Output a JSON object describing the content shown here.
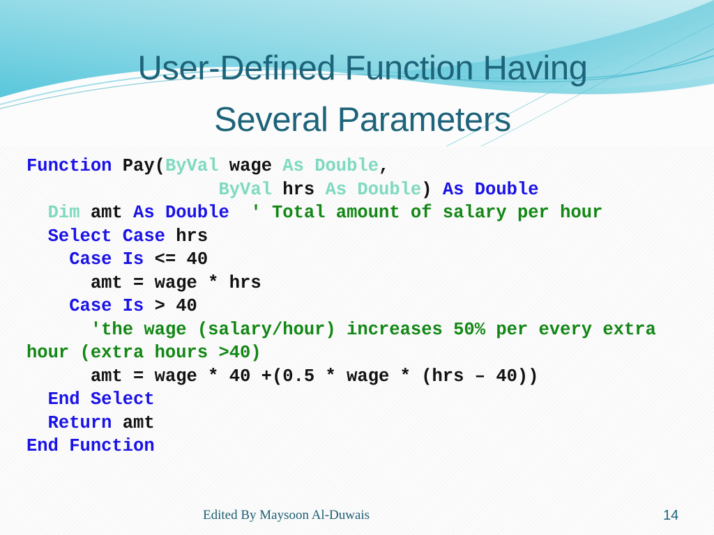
{
  "slide": {
    "title_lines": [
      "User-Defined Function Having",
      "Several Parameters"
    ],
    "footer_credit": "Edited By Maysoon Al-Duwais",
    "page_number": "14",
    "colors": {
      "title": "#1d6379",
      "keyword_blue": "#1a12e6",
      "type_mint": "#7fd9c0",
      "comment_green": "#128715",
      "plain_black": "#111111",
      "accent_cyan": "#5ec8dd",
      "accent_teal": "#25a9bc",
      "background": "#fcfcfc"
    }
  },
  "code": {
    "lines": [
      {
        "id": "line-signature-1",
        "indent": 0,
        "spans": [
          {
            "text": "Function ",
            "style": "kw"
          },
          {
            "text": "Pay(",
            "style": "plain"
          },
          {
            "text": "ByVal ",
            "style": "type"
          },
          {
            "text": "wage ",
            "style": "plain"
          },
          {
            "text": "As Double",
            "style": "type"
          },
          {
            "text": ",",
            "style": "plain"
          }
        ]
      },
      {
        "id": "line-signature-2",
        "indent": 9,
        "spans": [
          {
            "text": "ByVal ",
            "style": "type"
          },
          {
            "text": "hrs ",
            "style": "plain"
          },
          {
            "text": "As Double",
            "style": "type"
          },
          {
            "text": ") ",
            "style": "plain"
          },
          {
            "text": "As Double",
            "style": "kw"
          }
        ]
      },
      {
        "id": "line-dim-amt",
        "indent": 1,
        "spans": [
          {
            "text": "Dim ",
            "style": "type"
          },
          {
            "text": "amt ",
            "style": "plain"
          },
          {
            "text": "As Double",
            "style": "kw"
          },
          {
            "text": "  ",
            "style": "plain"
          },
          {
            "text": "' Total amount of salary per hour",
            "style": "comment"
          }
        ]
      },
      {
        "id": "line-select-case",
        "indent": 1,
        "spans": [
          {
            "text": "Select Case ",
            "style": "kw"
          },
          {
            "text": "hrs",
            "style": "plain"
          }
        ]
      },
      {
        "id": "line-case-le-40",
        "indent": 2,
        "spans": [
          {
            "text": "Case Is ",
            "style": "kw"
          },
          {
            "text": "<= 40",
            "style": "plain"
          }
        ]
      },
      {
        "id": "line-amt-normal",
        "indent": 3,
        "spans": [
          {
            "text": "amt = wage * hrs",
            "style": "plain"
          }
        ]
      },
      {
        "id": "line-case-gt-40",
        "indent": 2,
        "spans": [
          {
            "text": "Case Is ",
            "style": "kw"
          },
          {
            "text": "> 40",
            "style": "plain"
          }
        ]
      },
      {
        "id": "line-comment-overtime",
        "indent": 3,
        "wrap": true,
        "spans": [
          {
            "text": "'the wage (salary/hour) increases 50% per every extra hour (extra hours >40)",
            "style": "comment"
          }
        ]
      },
      {
        "id": "line-amt-overtime",
        "indent": 3,
        "spans": [
          {
            "text": "amt = wage * 40 +(0.5 * wage * (hrs – 40))",
            "style": "plain"
          }
        ]
      },
      {
        "id": "line-end-select",
        "indent": 1,
        "spans": [
          {
            "text": "End Select",
            "style": "kw"
          }
        ]
      },
      {
        "id": "line-return-amt",
        "indent": 1,
        "spans": [
          {
            "text": "Return ",
            "style": "kw"
          },
          {
            "text": "amt",
            "style": "plain"
          }
        ]
      },
      {
        "id": "line-end-function",
        "indent": 0,
        "spans": [
          {
            "text": "End Function",
            "style": "kw"
          }
        ]
      }
    ]
  }
}
